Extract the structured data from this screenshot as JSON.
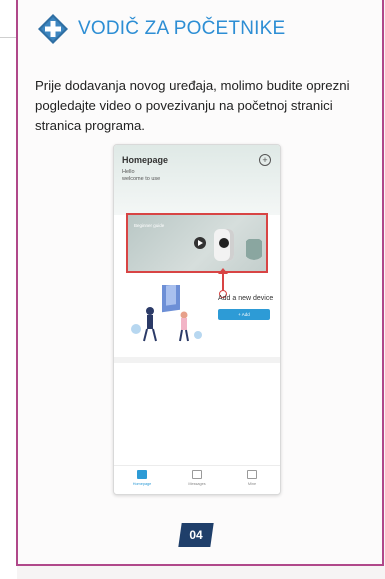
{
  "header": {
    "title": "VODIČ ZA POČETNIKE",
    "icon": "plus-diamond-icon",
    "title_color": "#2d8ed4",
    "icon_color": "#2f6fa3"
  },
  "intro": {
    "text": "Prije dodavanja novog uređaja, molimo budite oprezni pogledajte video o povezivanju na početnoj stranici stranica programa."
  },
  "phone": {
    "title": "Homepage",
    "greeting_line1": "Hello",
    "greeting_line2": "welcome to use",
    "video_label": "Beginner guide",
    "add_device_text": "Add a new device",
    "add_button_label": "+ Add",
    "nav": [
      {
        "label": "Homepage",
        "icon": "home-icon"
      },
      {
        "label": "Messages",
        "icon": "message-icon"
      },
      {
        "label": "Mine",
        "icon": "user-icon"
      }
    ],
    "highlight_color": "#d84444",
    "accent_color": "#2d9bd6"
  },
  "footer": {
    "page_number": "04",
    "badge_color": "#1f3f6a"
  },
  "frame": {
    "border_color": "#b0488a"
  }
}
